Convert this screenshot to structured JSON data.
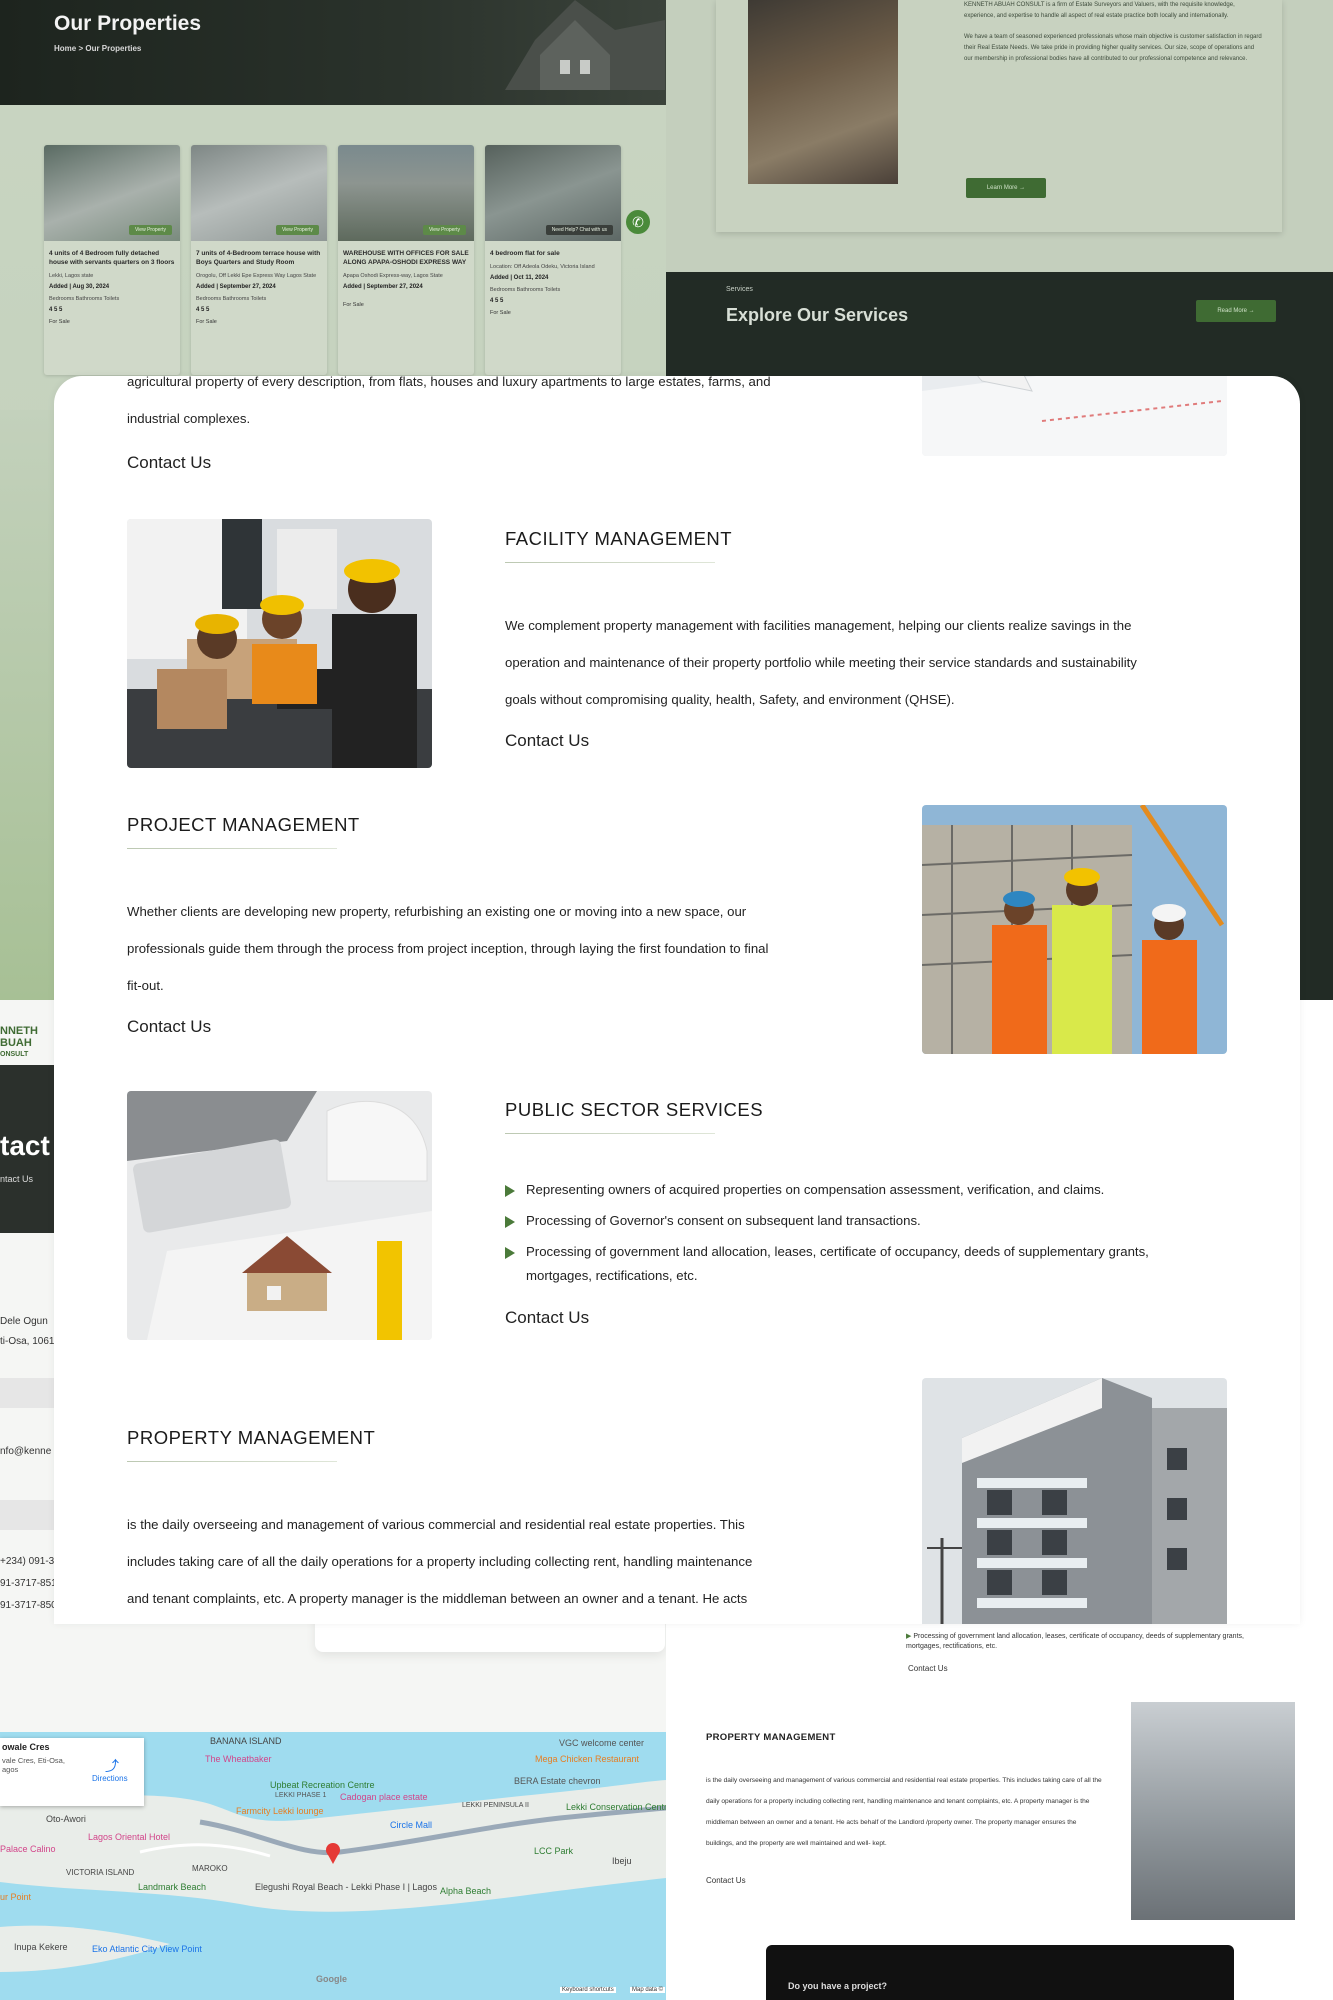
{
  "bg_properties": {
    "title": "Our Properties",
    "breadcrumb": "Home > Our Properties",
    "cards": [
      {
        "button": "View Property",
        "title": "4 units of 4 Bedroom fully detached house with servants quarters on 3 floors",
        "location": "Lekki, Lagos state",
        "added": "Added | Aug 30, 2024",
        "labels": "Bedrooms   Bathrooms   Toilets",
        "counts": "4   5   5",
        "status": "For Sale"
      },
      {
        "button": "View Property",
        "title": "7 units of 4-Bedroom terrace house with Boys Quarters and Study Room",
        "location": "Orogolu, Off Lekki Epe Express Way Lagos State",
        "added": "Added | September 27, 2024",
        "labels": "Bedrooms   Bathrooms   Toilets",
        "counts": "4   5   5",
        "status": "For Sale"
      },
      {
        "button": "View Property",
        "title": "WAREHOUSE WITH OFFICES FOR SALE ALONG APAPA-OSHODI EXPRESS WAY",
        "location": "Apapa Oshodi Express-way, Lagos State",
        "added": "Added | September 27, 2024",
        "labels": "",
        "counts": "",
        "status": "For Sale"
      },
      {
        "button": "Need Help? Chat with us",
        "title": "4 bedroom flat for sale",
        "location": "Location: Off Adeola Odeku, Victoria Island",
        "added": "Added | Oct 11, 2024",
        "labels": "Bedrooms   Bathrooms   Toilets",
        "counts": "4   5   5",
        "status": "For Sale"
      }
    ]
  },
  "bg_about": {
    "para1": "KENNETH ABUAH CONSULT is a firm of Estate Surveyors and Valuers, with the requisite knowledge, experience, and expertise to handle all aspect of real estate practice both locally and internationally.",
    "para2": "We have a team of seasoned experienced professionals whose main objective is customer satisfaction in regard their Real Estate Needs. We take pride in providing higher quality services. Our size, scope of operations and our membership in professional bodies have all contributed to our professional competence and relevance.",
    "learn_more": "Learn More →",
    "services_label": "Services",
    "services_title": "Explore Our Services",
    "read_more": "Read More →"
  },
  "bg_contact": {
    "logo_line1": "NNETH",
    "logo_line2": "BUAH",
    "logo_line3": "ONSULT",
    "hero_title": "tact",
    "hero_sub": "ntact Us",
    "address1": "Dele Ogun",
    "address2": "ti-Osa, 1061",
    "email": "nfo@kenne",
    "phone1": "+234) 091-37",
    "phone2": "91-3717-8511",
    "phone3": "91-3717-8506"
  },
  "map": {
    "place_title": "owale Cres",
    "place_sub": "vale Cres, Eti-Osa, agos",
    "directions": "Directions",
    "labels": [
      "BANANA ISLAND",
      "The Wheatbaker",
      "VGC welcome center",
      "Mega Chicken Restaurant",
      "BERA Estate chevron",
      "Upbeat Recreation Centre",
      "LEKKI PHASE 1",
      "Cadogan place estate",
      "Farmcity Lekki lounge",
      "Oto-Awori",
      "Lagos Oriental Hotel",
      "Circle Mall",
      "LEKKI PENINSULA II",
      "Lekki Conservation Centre",
      "LCC Park",
      "Palace Calino",
      "VICTORIA ISLAND",
      "MAROKO",
      "Ibeju",
      "Landmark Beach",
      "Elegushi Royal Beach - Lekki Phase I | Lagos",
      "Alpha Beach",
      "Inupa Kekere",
      "Eko Atlantic City View Point",
      "Google",
      "Keyboard shortcuts",
      "Map data ©",
      "ur Point"
    ]
  },
  "bg_right": {
    "bullet": "Processing of government land allocation, leases, certificate of occupancy, deeds of supplementary grants, mortgages, rectifications, etc.",
    "contact": "Contact Us",
    "heading": "PROPERTY MANAGEMENT",
    "body": "is the daily overseeing and management of various commercial and residential real estate properties. This includes taking care of all the daily operations for a property including collecting rent, handling maintenance and tenant complaints, etc. A property manager is the middleman between an owner and a tenant. He acts behalf of the Landlord /property owner. The property manager ensures the buildings, and the property are well maintained and well- kept.",
    "footer": "Do you have a project?"
  },
  "main": {
    "intro_line1": "agricultural property of every description, from flats, houses and luxury apartments to large estates, farms, and",
    "intro_line2": "industrial complexes.",
    "intro_contact": "Contact Us",
    "facility": {
      "heading": "FACILITY MANAGEMENT",
      "line1": "We complement property management with facilities management, helping our clients realize savings in the",
      "line2": "operation and maintenance of their property portfolio while meeting their service standards and sustainability",
      "line3": "goals without compromising quality, health, Safety, and environment (QHSE).",
      "contact": "Contact Us"
    },
    "project": {
      "heading": "PROJECT MANAGEMENT",
      "line1": "Whether clients are developing new property, refurbishing an existing one or moving into a new space, our",
      "line2": "professionals guide them through the process from project inception, through laying the first foundation to final",
      "line3": "fit-out.",
      "contact": "Contact Us"
    },
    "public": {
      "heading": "PUBLIC SECTOR SERVICES",
      "bullets": [
        "Representing owners of acquired properties on compensation assessment, verification, and claims.",
        "Processing of Governor's consent on subsequent land transactions.",
        "Processing of government land allocation, leases, certificate of occupancy, deeds of supplementary grants,",
        "mortgages, rectifications, etc."
      ],
      "contact": "Contact Us"
    },
    "property": {
      "heading": "PROPERTY MANAGEMENT",
      "line1": "is the daily overseeing and management of various commercial and residential real estate properties. This",
      "line2": "includes taking care of all the daily operations for a property including collecting rent, handling maintenance",
      "line3": "and tenant complaints, etc. A property manager is the middleman between an owner and a tenant. He acts"
    }
  }
}
